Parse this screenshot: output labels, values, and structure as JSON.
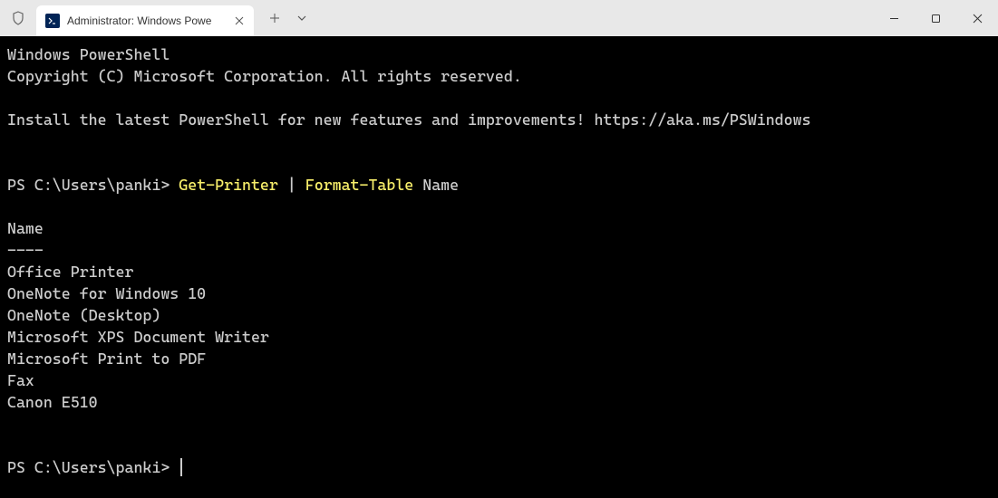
{
  "titlebar": {
    "tab_title": "Administrator: Windows Powe"
  },
  "terminal": {
    "line1": "Windows PowerShell",
    "line2": "Copyright (C) Microsoft Corporation. All rights reserved.",
    "line3": "Install the latest PowerShell for new features and improvements! https://aka.ms/PSWindows",
    "prompt1_prefix": "PS C:\\Users\\panki> ",
    "cmd1": "Get-Printer",
    "pipe": " | ",
    "cmd2": "Format-Table",
    "arg": " Name",
    "header": "Name",
    "divider": "----",
    "rows": [
      "Office Printer",
      "OneNote for Windows 10",
      "OneNote (Desktop)",
      "Microsoft XPS Document Writer",
      "Microsoft Print to PDF",
      "Fax",
      "Canon E510"
    ],
    "prompt2_prefix": "PS C:\\Users\\panki> "
  }
}
